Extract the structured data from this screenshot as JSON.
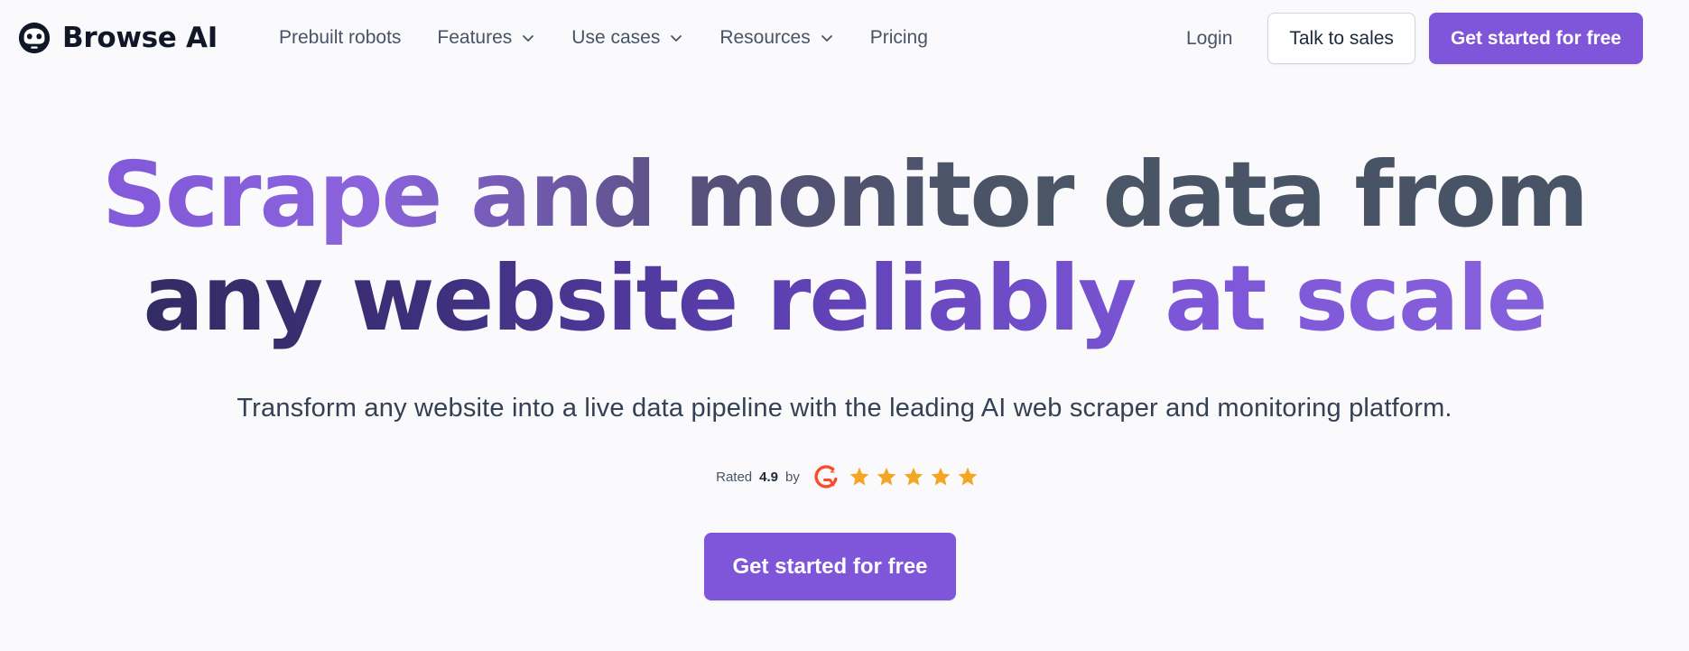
{
  "brand": {
    "name": "Browse AI",
    "logo_icon": "robot-head-icon"
  },
  "nav": {
    "links": [
      {
        "label": "Prebuilt robots",
        "has_dropdown": false
      },
      {
        "label": "Features",
        "has_dropdown": true
      },
      {
        "label": "Use cases",
        "has_dropdown": true
      },
      {
        "label": "Resources",
        "has_dropdown": true
      },
      {
        "label": "Pricing",
        "has_dropdown": false
      }
    ],
    "login": "Login",
    "talk_to_sales": "Talk to sales",
    "get_started": "Get started for free"
  },
  "hero": {
    "title_line_1": "Scrape and monitor data from",
    "title_line_2": "any website reliably at scale",
    "subtitle": "Transform any website into a live data pipeline with the leading AI web scraper and monitoring platform."
  },
  "rating": {
    "prefix": "Rated",
    "value": "4.9",
    "by": "by",
    "source_icon": "g2-logo-icon",
    "stars": 5
  },
  "cta": {
    "label": "Get started for free"
  },
  "colors": {
    "brand_purple": "#7f56d9",
    "star_gold": "#f5a524",
    "g2_red": "#ff492c"
  }
}
